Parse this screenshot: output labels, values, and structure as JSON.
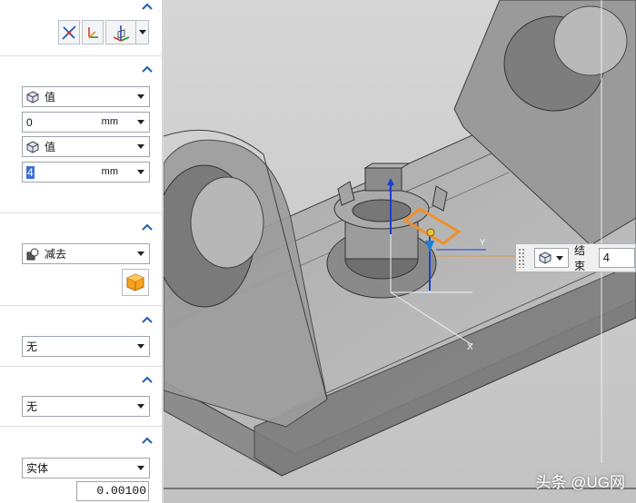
{
  "panel": {
    "toolbar_tooltip_icons": [
      "snap-vector-icon",
      "csys-icon",
      "point-triad-icon"
    ],
    "limits": {
      "start": {
        "option": "值",
        "value": "0",
        "unit": "mm"
      },
      "end": {
        "option": "值",
        "value": "4",
        "unit": "mm"
      }
    },
    "boolean": {
      "option": "减去"
    },
    "draft": {
      "option": "无"
    },
    "offset": {
      "option": "无"
    },
    "settings": {
      "body_type": "实体",
      "tolerance": "0.00100"
    }
  },
  "floating_widget": {
    "label": "结束",
    "value": "4"
  },
  "watermark": "头条 @UG网",
  "colors": {
    "accent_blue": "#1f5fb3",
    "highlight_orange": "#f0902a",
    "viewport_bg": "#c9c9c9",
    "selection_blue": "#3b6fd6"
  }
}
